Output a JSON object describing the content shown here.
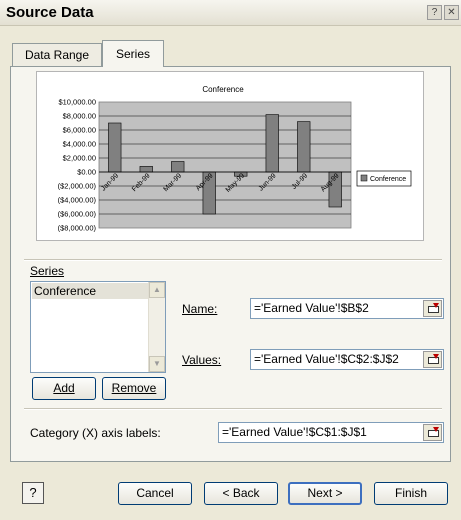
{
  "window": {
    "title": "Source Data",
    "help_glyph": "?",
    "close_glyph": "✕"
  },
  "tabs": [
    {
      "label": "Data Range",
      "active": false
    },
    {
      "label": "Series",
      "active": true
    }
  ],
  "chart_data": {
    "type": "bar",
    "title": "Conference",
    "categories": [
      "Jan-99",
      "Feb-99",
      "Mar-99",
      "Apr-99",
      "May-99",
      "Jun-99",
      "Jul-99",
      "Aug-99"
    ],
    "series": [
      {
        "name": "Conference",
        "values": [
          7000,
          800,
          1500,
          -6000,
          -600,
          8200,
          7200,
          -5000
        ]
      }
    ],
    "ylim": [
      -8000,
      10000
    ],
    "y_ticks": [
      "$10,000.00",
      "$8,000.00",
      "$6,000.00",
      "$4,000.00",
      "$2,000.00",
      "$0.00",
      "($2,000.00)",
      "($4,000.00)",
      "($6,000.00)",
      "($8,000.00)"
    ],
    "y_tick_values": [
      10000,
      8000,
      6000,
      4000,
      2000,
      0,
      -2000,
      -4000,
      -6000,
      -8000
    ],
    "grid": true,
    "legend": "right",
    "colors": {
      "bar": "#808080",
      "plot_bg": "#c0c0c0"
    }
  },
  "series_section": {
    "label": "Series",
    "items": [
      "Conference"
    ],
    "add_label": "Add",
    "remove_label": "Remove"
  },
  "name_field": {
    "label": "Name:",
    "value": "='Earned Value'!$B$2"
  },
  "values_field": {
    "label": "Values:",
    "value": "='Earned Value'!$C$2:$J$2"
  },
  "category_field": {
    "label": "Category (X) axis labels:",
    "value": "='Earned Value'!$C$1:$J$1"
  },
  "footer": {
    "help_glyph": "?",
    "cancel_label": "Cancel",
    "back_label": "< Back",
    "next_label": "Next >",
    "finish_label": "Finish"
  }
}
